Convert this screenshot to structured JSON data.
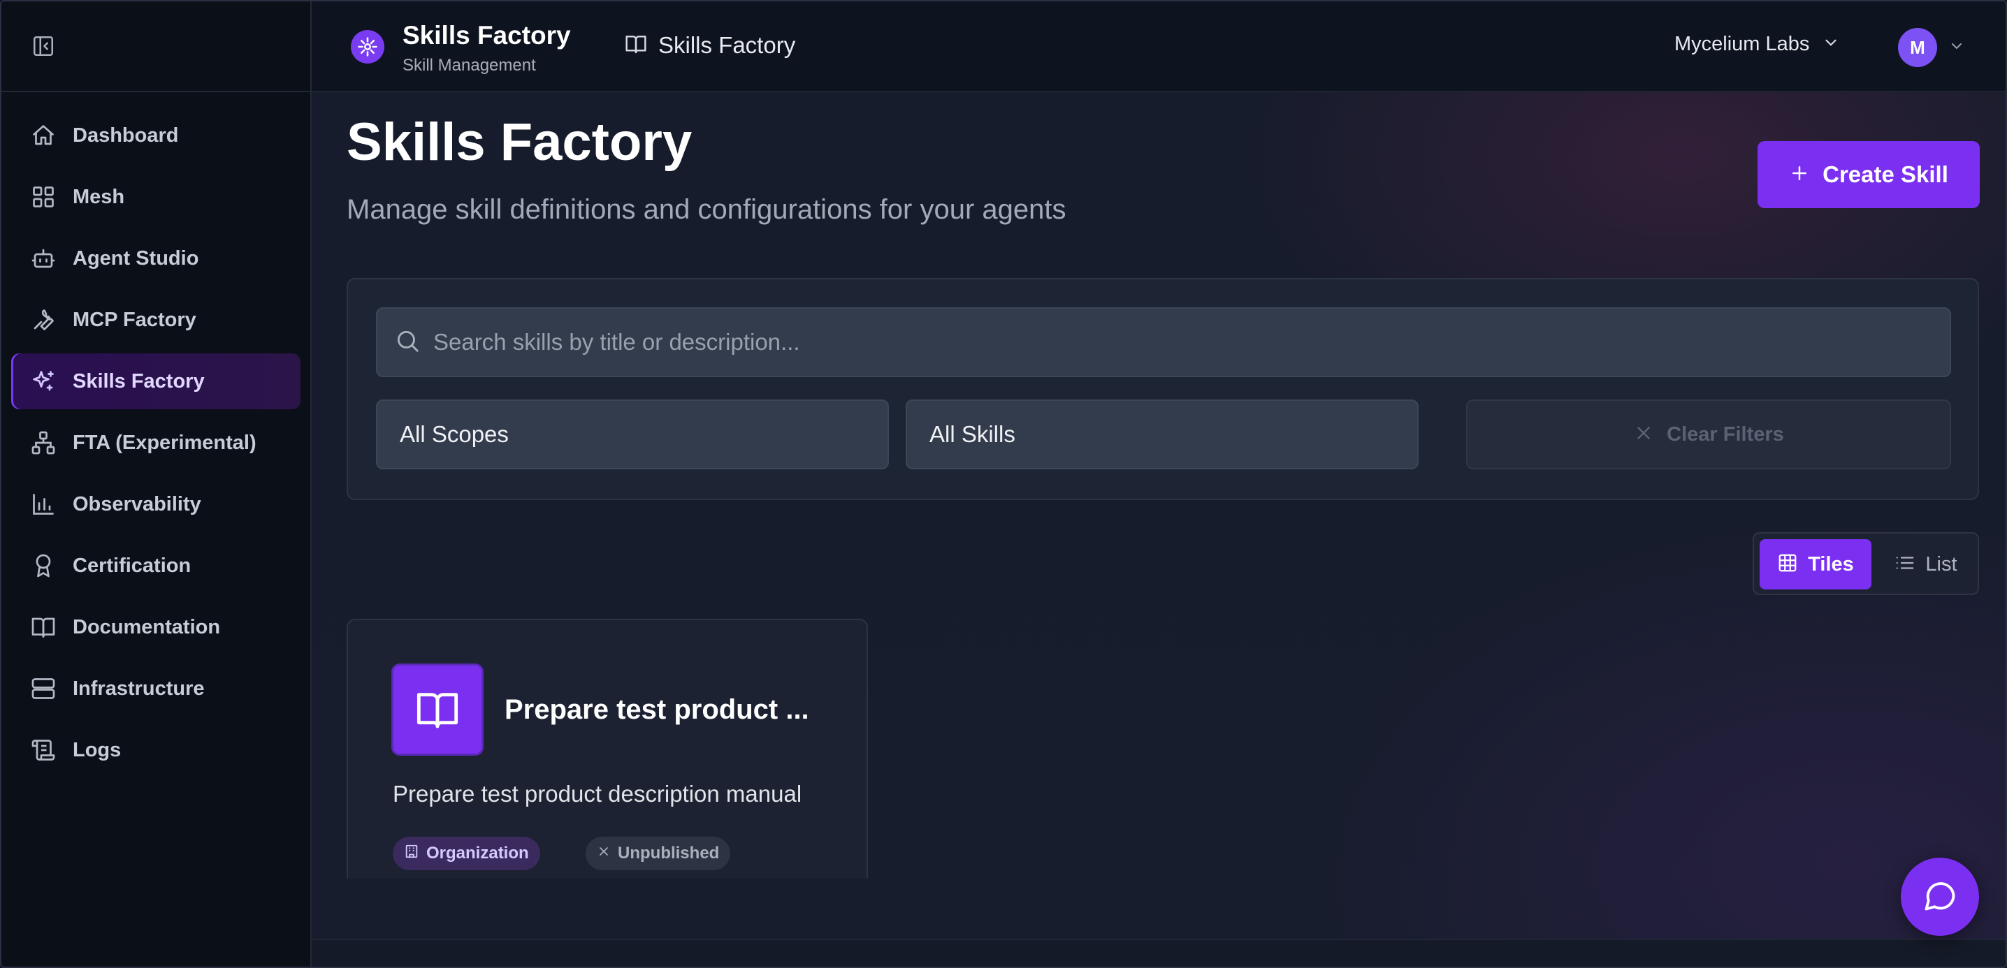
{
  "sidebar": {
    "collapse_icon": "sidebar-collapse-icon",
    "items": [
      {
        "label": "Dashboard",
        "icon": "home-icon",
        "active": false
      },
      {
        "label": "Mesh",
        "icon": "grid-icon",
        "active": false
      },
      {
        "label": "Agent Studio",
        "icon": "bot-icon",
        "active": false
      },
      {
        "label": "MCP Factory",
        "icon": "wrench-icon",
        "active": false
      },
      {
        "label": "Skills Factory",
        "icon": "sparkles-icon",
        "active": true
      },
      {
        "label": "FTA (Experimental)",
        "icon": "network-icon",
        "active": false
      },
      {
        "label": "Observability",
        "icon": "bar-chart-icon",
        "active": false
      },
      {
        "label": "Certification",
        "icon": "award-icon",
        "active": false
      },
      {
        "label": "Documentation",
        "icon": "book-icon",
        "active": false
      },
      {
        "label": "Infrastructure",
        "icon": "server-icon",
        "active": false
      },
      {
        "label": "Logs",
        "icon": "scroll-icon",
        "active": false
      }
    ]
  },
  "header": {
    "brand_title": "Skills Factory",
    "brand_subtitle": "Skill Management",
    "breadcrumb": "Skills Factory",
    "org": "Mycelium Labs",
    "avatar_initial": "M"
  },
  "main": {
    "title": "Skills Factory",
    "subtitle": "Manage skill definitions and configurations for your agents",
    "create_button": "Create Skill",
    "search": {
      "placeholder": "Search skills by title or description...",
      "value": ""
    },
    "filters": {
      "scope": "All Scopes",
      "skills": "All Skills",
      "clear": "Clear Filters"
    },
    "view_toggle": {
      "tiles": "Tiles",
      "list": "List",
      "selected": "Tiles"
    },
    "skills": [
      {
        "title": "Prepare test product description manual",
        "title_display": "Prepare test product ...",
        "description": "Prepare test product description manual",
        "scope_badge": "Organization",
        "status_badge": "Unpublished"
      }
    ]
  },
  "colors": {
    "accent": "#7b2ff0",
    "background": "#161c2b",
    "sidebar": "#0b0f18"
  }
}
